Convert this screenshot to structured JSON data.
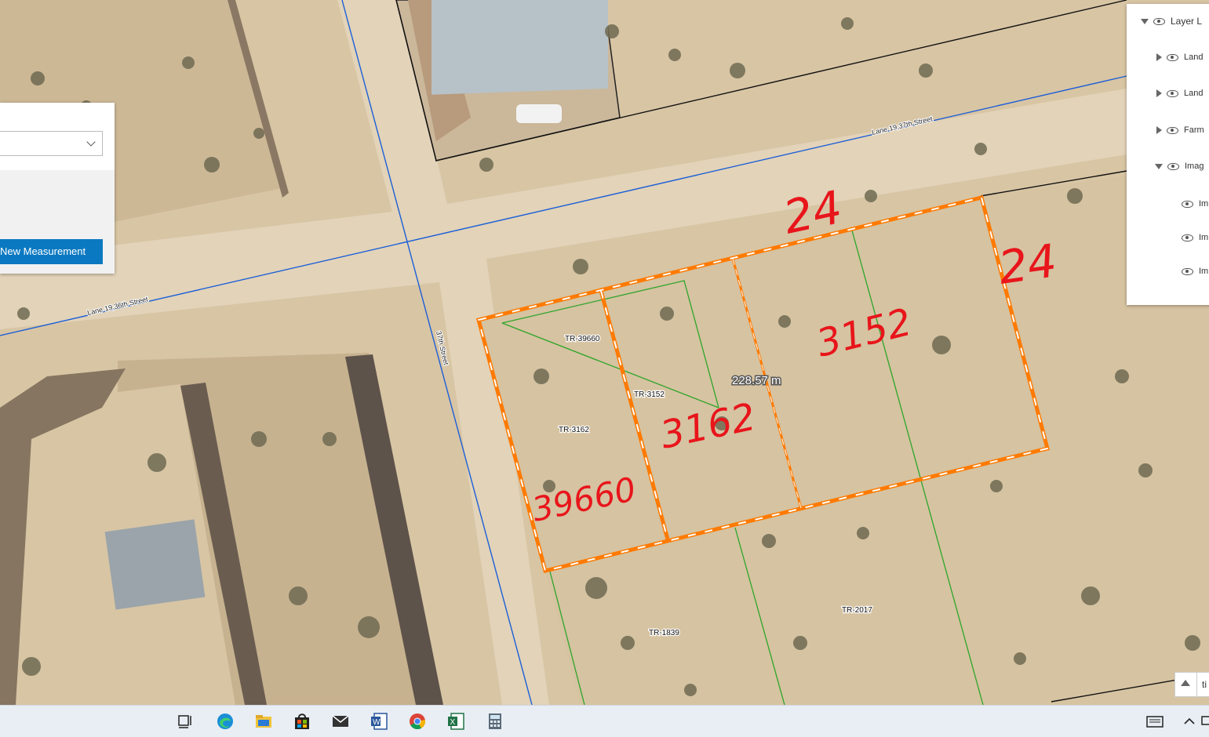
{
  "map": {
    "streets": [
      "Lane 19,37th Street",
      "Lane 19,36th Street",
      "37th Street"
    ],
    "parcels": [
      "TR-39660",
      "TR-3152",
      "TR-3162",
      "TR-2017",
      "TR-1839"
    ],
    "measurement": "228.57 m",
    "handwritten": {
      "top_dimension": "24",
      "right_dimension": "24",
      "plot_a": "3152",
      "plot_b": "3162",
      "plot_c": "39660"
    },
    "colors": {
      "parcel_boundary": "#2ea52a",
      "street_line": "#1c5fd6",
      "measure_outline": "#ff7a00",
      "annotation_ink": "#e8151b"
    }
  },
  "measure_panel": {
    "button_label": "New Measurement"
  },
  "layer_list": {
    "title": "Layer L",
    "items": [
      {
        "label": "Land",
        "type": "collapsed"
      },
      {
        "label": "Land",
        "type": "collapsed"
      },
      {
        "label": "Farm",
        "type": "collapsed"
      },
      {
        "label": "Imag",
        "type": "expanded"
      },
      {
        "label": "Im",
        "type": "child"
      },
      {
        "label": "Im",
        "type": "child"
      },
      {
        "label": "Im",
        "type": "child"
      }
    ]
  },
  "map_corner": {
    "label": "ti"
  },
  "taskbar": {
    "icons": [
      "task-view-icon",
      "edge-icon",
      "file-explorer-icon",
      "store-icon",
      "mail-icon",
      "word-icon",
      "chrome-icon",
      "excel-icon",
      "calculator-icon"
    ]
  }
}
